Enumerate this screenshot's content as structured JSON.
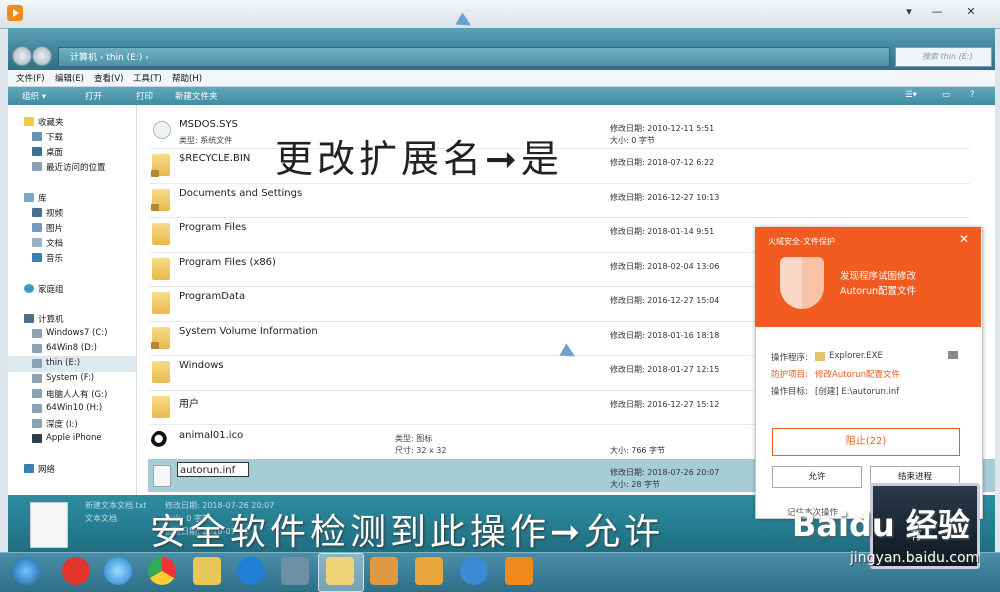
{
  "address": {
    "path": "计算机 › thin (E:) ›",
    "search_placeholder": "搜索 thin (E:)"
  },
  "menu": [
    "文件(F)",
    "编辑(E)",
    "查看(V)",
    "工具(T)",
    "帮助(H)"
  ],
  "toolbar": [
    "组织 ▾",
    "打开",
    "打印",
    "新建文件夹"
  ],
  "nav": {
    "favorites": "收藏夹",
    "fav_items": [
      "下载",
      "桌面",
      "最近访问的位置"
    ],
    "library": "库",
    "lib_items": [
      "视频",
      "图片",
      "文档",
      "音乐"
    ],
    "homegroup": "家庭组",
    "computer": "计算机",
    "drives": [
      "Windows7 (C:)",
      "64Win8 (D:)",
      "thin (E:)",
      "System (F:)",
      "电脑人人有 (G:)",
      "64Win10 (H:)",
      "深度 (I:)",
      "Apple iPhone"
    ],
    "network": "网络"
  },
  "files": [
    {
      "name": "MSDOS.SYS",
      "type": "类型: 系统文件",
      "modified": "修改日期: 2010-12-11 5:51",
      "size": "大小: 0 字节"
    },
    {
      "name": "$RECYCLE.BIN",
      "modified": "修改日期: 2018-07-12 6:22"
    },
    {
      "name": "Documents and Settings",
      "modified": "修改日期: 2016-12-27 10:13"
    },
    {
      "name": "Program Files",
      "modified": "修改日期: 2018-01-14 9:51"
    },
    {
      "name": "Program Files (x86)",
      "modified": "修改日期: 2018-02-04 13:06"
    },
    {
      "name": "ProgramData",
      "modified": "修改日期: 2016-12-27 15:04"
    },
    {
      "name": "System Volume Information",
      "modified": "修改日期: 2018-01-16 18:18"
    },
    {
      "name": "Windows",
      "modified": "修改日期: 2018-01-27 12:15"
    },
    {
      "name": "用户",
      "modified": "修改日期: 2016-12-27 15:12"
    },
    {
      "name": "animal01.ico",
      "type": "类型: 图标",
      "dims": "尺寸: 32 x 32",
      "size": "大小: 766 字节"
    },
    {
      "name": "autorun.inf",
      "modified": "修改日期: 2018-07-26 20:07",
      "size": "大小: 28 字节"
    }
  ],
  "details": {
    "name": "新建文本文档.txt",
    "modified": "修改日期: 2018-07-26 20:07",
    "type": "文本文档",
    "size": "大小: 0 字节",
    "created": "创建日期: 2018-07-26"
  },
  "captions": {
    "top": "更改扩展名➞是",
    "bottom": "安全软件检测到此操作➞允许"
  },
  "popup": {
    "title": "火绒安全-文件保护",
    "message_line1": "发现程序试图修改",
    "message_line2": "Autorun配置文件",
    "program_label": "操作程序:",
    "program_value": "Explorer.EXE",
    "project_label": "防护项目:",
    "project_value": "修改Autorun配置文件",
    "target_label": "操作目标:",
    "target_value": "[创建] E:\\autorun.inf",
    "block_button": "阻止(22)",
    "allow_button": "允许",
    "end_button": "结束进程",
    "remember": "记住本次操作"
  },
  "watermark": {
    "brand": "Baidu 经验",
    "url": "jingyan.baidu.com",
    "laptop_text": "有"
  },
  "colors": {
    "popup_accent": "#f25b1f",
    "window_teal": "#3f8ca2",
    "selection": "#a6cdd6"
  }
}
